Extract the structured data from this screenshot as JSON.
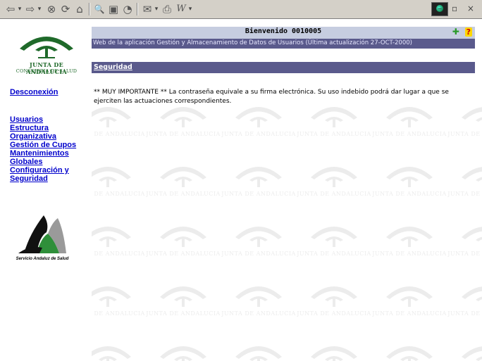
{
  "toolbar": {
    "buttons": [
      {
        "icon": "back-arrow-icon",
        "glyph": "⇦"
      },
      {
        "icon": "forward-arrow-icon",
        "glyph": "⇨"
      },
      {
        "icon": "stop-icon",
        "glyph": "⊗"
      },
      {
        "icon": "refresh-icon",
        "glyph": "⟳"
      },
      {
        "icon": "home-icon",
        "glyph": "⌂"
      },
      {
        "icon": "search-icon",
        "glyph": "🔍"
      },
      {
        "icon": "favorites-icon",
        "glyph": "▣"
      },
      {
        "icon": "history-icon",
        "glyph": "◔"
      },
      {
        "icon": "mail-icon",
        "glyph": "✉"
      },
      {
        "icon": "print-icon",
        "glyph": "⎙"
      },
      {
        "icon": "edit-icon",
        "glyph": "W"
      }
    ],
    "window_controls": "– ▫ ×"
  },
  "sidebar": {
    "logo_org_line1": "JUNTA DE ANDALUCIA",
    "logo_org_line2": "CONSEJERIA DE SALUD",
    "disconnect": "Desconexión",
    "menu": [
      "Usuarios",
      "Estructura",
      "Organizativa",
      "Gestión de Cupos",
      "Mantenimientos",
      "Globales",
      "Configuración y",
      "Seguridad"
    ],
    "sas_logo_text": "Servicio Andaluz de Salud"
  },
  "header": {
    "welcome": "Bienvenido 0010005",
    "subtitle": "Web de la aplicación Gestión y Almacenamiento de Datos de Usuarios (Última actualización 27-OCT-2000)"
  },
  "section": {
    "title": "Seguridad"
  },
  "notice": {
    "text": "** MUY IMPORTANTE ** La contraseña equivale a su firma electrónica. Su uso indebido podrá dar lugar a que se ejerciten las actuaciones correspondientes."
  },
  "watermark": {
    "text": "JUNTA DE ANDALUCIA"
  },
  "colors": {
    "header_light": "#c6cde0",
    "header_dark": "#5a5a8c",
    "link": "#0000cc",
    "logo_green": "#1f6a2a"
  }
}
